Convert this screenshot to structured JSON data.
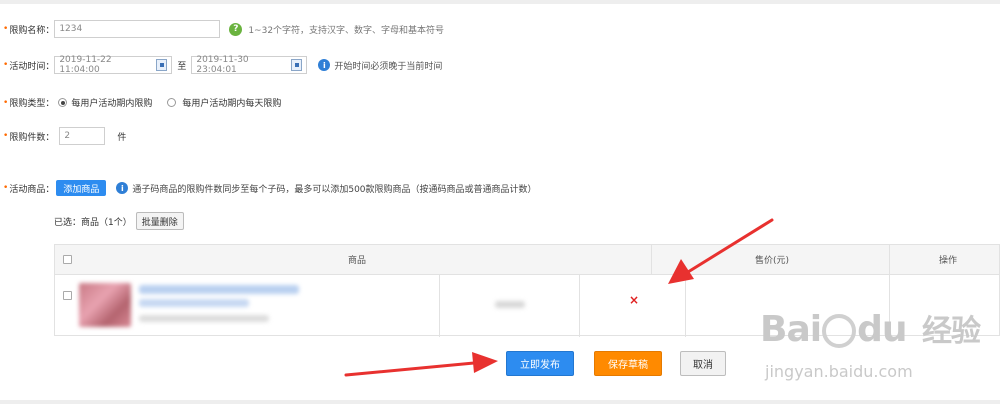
{
  "form": {
    "name": {
      "label": "限购名称：",
      "value": "1234",
      "hint": "1~32个字符，支持汉字、数字、字母和基本符号"
    },
    "time": {
      "label": "活动时间：",
      "start": "2019-11-22 11:04:00",
      "sep": "至",
      "end": "2019-11-30 23:04:01",
      "hint": "开始时间必须晚于当前时间"
    },
    "type": {
      "label": "限购类型：",
      "options": [
        "每用户活动期内限购",
        "每用户活动期内每天限购"
      ]
    },
    "qty": {
      "label": "限购件数：",
      "value": "2",
      "unit": "件"
    },
    "goods": {
      "label": "活动商品：",
      "add_button": "添加商品",
      "hint": "通子码商品的限购件数同步至每个子码，最多可以添加500款限购商品（按通码商品或普通商品计数）",
      "selected": "已选：商品（1个）",
      "batch_delete": "批量删除"
    }
  },
  "table": {
    "headers": {
      "product": "商品",
      "price": "售价(元)",
      "action": "操作"
    },
    "delete_mark": "×"
  },
  "actions": {
    "publish": "立即发布",
    "draft": "保存草稿",
    "cancel": "取消"
  },
  "watermark": {
    "brand": "Bai",
    "brand2": "du",
    "cn": "经验",
    "url": "jingyan.baidu.com"
  },
  "colors": {
    "primary": "#2d8cf0",
    "draft": "#ff8a00",
    "required": "#ff6a00",
    "arrow": "#e8312f"
  },
  "icons": {
    "help": "?",
    "info": "i"
  }
}
